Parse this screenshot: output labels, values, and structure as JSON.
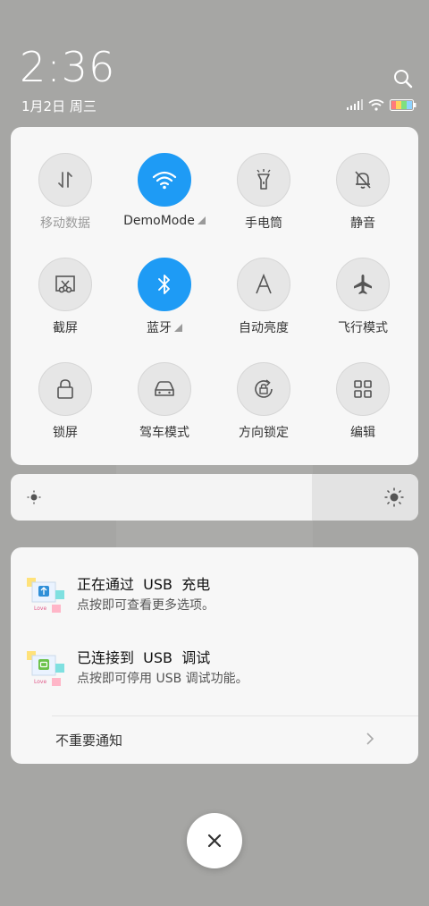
{
  "status": {
    "time": "2:36",
    "date": "1月2日 周三"
  },
  "quick_settings": [
    {
      "label": "移动数据",
      "icon": "mobile-data-icon",
      "on": false,
      "dim": true
    },
    {
      "label": "DemoMode",
      "icon": "wifi-icon",
      "on": true,
      "dim": false
    },
    {
      "label": "手电筒",
      "icon": "flashlight-icon",
      "on": false,
      "dim": false
    },
    {
      "label": "静音",
      "icon": "mute-bell-icon",
      "on": false,
      "dim": false
    },
    {
      "label": "截屏",
      "icon": "screenshot-icon",
      "on": false,
      "dim": false
    },
    {
      "label": "蓝牙",
      "icon": "bluetooth-icon",
      "on": true,
      "dim": false
    },
    {
      "label": "自动亮度",
      "icon": "auto-brightness-icon",
      "on": false,
      "dim": false
    },
    {
      "label": "飞行模式",
      "icon": "airplane-icon",
      "on": false,
      "dim": false
    },
    {
      "label": "锁屏",
      "icon": "lock-icon",
      "on": false,
      "dim": false
    },
    {
      "label": "驾车模式",
      "icon": "car-icon",
      "on": false,
      "dim": false
    },
    {
      "label": "方向锁定",
      "icon": "rotation-lock-icon",
      "on": false,
      "dim": false
    },
    {
      "label": "编辑",
      "icon": "edit-grid-icon",
      "on": false,
      "dim": false
    }
  ],
  "notifications": [
    {
      "title": "正在通过  USB  充电",
      "subtitle": "点按即可查看更多选项。"
    },
    {
      "title": "已连接到  USB  调试",
      "subtitle": "点按即可停用 USB 调试功能。"
    }
  ],
  "unimportant_label": "不重要通知",
  "colors": {
    "accent": "#1e9bf5",
    "background": "#a6a6a4",
    "panel": "#f7f7f7"
  }
}
